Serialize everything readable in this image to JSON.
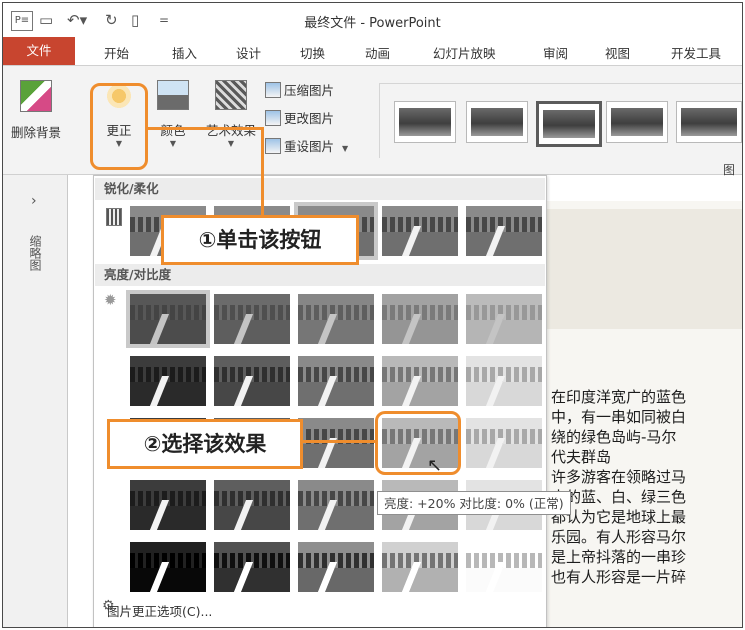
{
  "window": {
    "title": "最终文件 - PowerPoint",
    "app_icon": "P≡"
  },
  "quick_access": {
    "save_icon": "save-icon",
    "undo_icon": "undo-icon",
    "redo_icon": "redo-icon",
    "new_icon": "new-file-icon",
    "customize_icon": "customize-icon"
  },
  "tabs": [
    {
      "label": "文件"
    },
    {
      "label": "开始"
    },
    {
      "label": "插入"
    },
    {
      "label": "设计"
    },
    {
      "label": "切换"
    },
    {
      "label": "动画"
    },
    {
      "label": "幻灯片放映"
    },
    {
      "label": "审阅"
    },
    {
      "label": "视图"
    },
    {
      "label": "开发工具"
    }
  ],
  "ribbon": {
    "remove_bg": "删除背景",
    "corrections": "更正",
    "color": "颜色",
    "artistic": "艺术效果",
    "compress": "压缩图片",
    "change": "更改图片",
    "reset": "重设图片",
    "right_cut": "图"
  },
  "panel": {
    "sharpen_header": "锐化/柔化",
    "brightness_header": "亮度/对比度",
    "options_link": "图片更正选项(C)..."
  },
  "rail": {
    "label": "缩略图"
  },
  "callouts": {
    "step1": "①单击该按钮",
    "step2": "②选择该效果"
  },
  "tooltip": "亮度: +20% 对比度: 0% (正常)",
  "slide_text": [
    "在印度洋宽广的蓝色",
    "中，有一串如同被白",
    "绕的绿色岛屿-马尔",
    "代夫群岛",
    "许多游客在领略过马",
    "大的蓝、白、绿三色",
    "都认为它是地球上最",
    "乐园。有人形容马尔",
    "是上帝抖落的一串珍",
    "也有人形容是一片碎"
  ],
  "colors": {
    "file_tab": "#c8452f",
    "highlight": "#ef8d2d"
  }
}
